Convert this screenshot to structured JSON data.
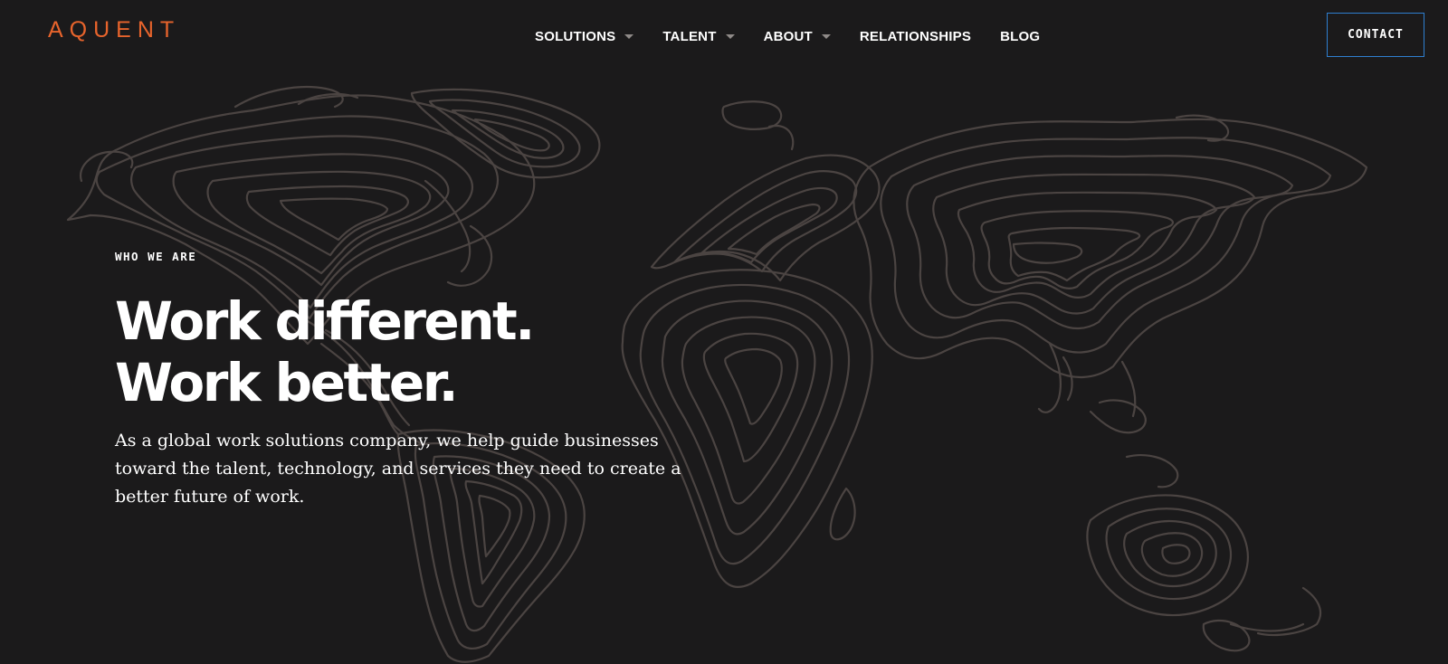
{
  "header": {
    "logo_text": "AQUENT",
    "nav": [
      {
        "label": "SOLUTIONS",
        "has_dropdown": true
      },
      {
        "label": "TALENT",
        "has_dropdown": true
      },
      {
        "label": "ABOUT",
        "has_dropdown": true
      },
      {
        "label": "RELATIONSHIPS",
        "has_dropdown": false
      },
      {
        "label": "BLOG",
        "has_dropdown": false
      }
    ],
    "contact_label": "CONTACT"
  },
  "hero": {
    "eyebrow": "WHO WE ARE",
    "headline_line1": "Work different.",
    "headline_line2": "Work better.",
    "body": "As a global work solutions company, we help guide businesses toward the talent, technology, and services they need to create a better future of work."
  },
  "colors": {
    "background": "#1b1a1b",
    "brand_orange": "#e8642c",
    "map_lines": "#4b4442",
    "contact_border": "#2f7fd0",
    "text": "#ffffff"
  }
}
